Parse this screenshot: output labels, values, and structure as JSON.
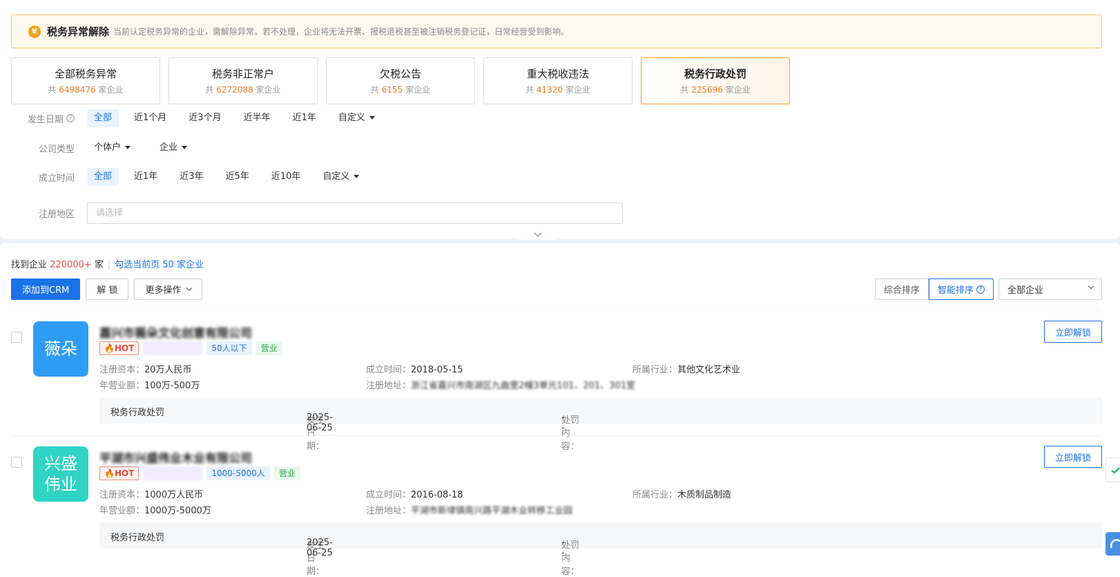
{
  "banner": {
    "icon": "yen-coin-icon",
    "title": "税务异常解除",
    "desc": "当前认定税务异常的企业，需解除异常。若不处理，企业将无法开票、报税退税甚至被注销税务登记证，日常经营受到影响。"
  },
  "cards": [
    {
      "title": "全部税务异常",
      "prefix": "共",
      "count": "6498476",
      "suffix": "家企业"
    },
    {
      "title": "税务非正常户",
      "prefix": "共",
      "count": "6272088",
      "suffix": "家企业"
    },
    {
      "title": "欠税公告",
      "prefix": "共",
      "count": "6155",
      "suffix": "家企业"
    },
    {
      "title": "重大税收违法",
      "prefix": "共",
      "count": "41320",
      "suffix": "家企业"
    },
    {
      "title": "税务行政处罚",
      "prefix": "共",
      "count": "225696",
      "suffix": "家企业"
    }
  ],
  "filters": {
    "date": {
      "label": "发生日期",
      "options": [
        "全部",
        "近1个月",
        "近3个月",
        "近半年",
        "近1年",
        "自定义"
      ]
    },
    "type": {
      "label": "公司类型",
      "options": [
        "个体户",
        "企业"
      ]
    },
    "founded": {
      "label": "成立时间",
      "options": [
        "全部",
        "近1年",
        "近3年",
        "近5年",
        "近10年",
        "自定义"
      ]
    },
    "region": {
      "label": "注册地区",
      "placeholder": "请选择"
    }
  },
  "results": {
    "prefix": "找到企业",
    "count": "220000+",
    "unit": "家",
    "select_page": "勾选当前页 50 家企业"
  },
  "toolbar": {
    "add_crm": "添加到CRM",
    "unlock": "解 锁",
    "more": "更多操作"
  },
  "sort": {
    "comprehensive": "综合排序",
    "smart": "智能排序",
    "scope": "全部企业"
  },
  "companies": [
    {
      "logo_text": "薇朵",
      "logo_color": "#2f9cf4",
      "name_visible": "嘉兴市薇朵文化创意有限公司",
      "tags": {
        "hot": "HOT",
        "size": "50人以下",
        "status": "营业"
      },
      "reg_capital_label": "注册资本：",
      "reg_capital": "20万人民币",
      "revenue_label": "年营业额：",
      "revenue": "100万-500万",
      "founded_label": "成立时间：",
      "founded": "2018-05-15",
      "address_label": "注册地址：",
      "address": "浙江省嘉兴市南湖区九曲里2幢3单元101、201、301室",
      "industry_label": "所属行业：",
      "industry": "其他文化艺术业",
      "penalty_type": "税务行政处罚",
      "penalty_date_label": "发生日期：",
      "penalty_date": "2025-06-25",
      "penalty_content_label": "处罚内容：",
      "penalty_content": "--",
      "unlock": "立即解锁"
    },
    {
      "logo_text": "兴盛\n伟业",
      "logo_color": "#2fd4c4",
      "name_visible": "平湖市兴盛伟业木业有限公司",
      "tags": {
        "hot": "HOT",
        "size": "1000-5000人",
        "status": "营业"
      },
      "reg_capital_label": "注册资本：",
      "reg_capital": "1000万人民币",
      "revenue_label": "年营业额：",
      "revenue": "1000万-5000万",
      "founded_label": "成立时间：",
      "founded": "2016-08-18",
      "address_label": "注册地址：",
      "address": "平湖市新埭镇南兴路平湖木业转移工业园",
      "industry_label": "所属行业：",
      "industry": "木质制品制造",
      "penalty_type": "税务行政处罚",
      "penalty_date_label": "发生日期：",
      "penalty_date": "2025-06-25",
      "penalty_content_label": "处罚内容：",
      "penalty_content": "--",
      "unlock": "立即解锁"
    }
  ]
}
